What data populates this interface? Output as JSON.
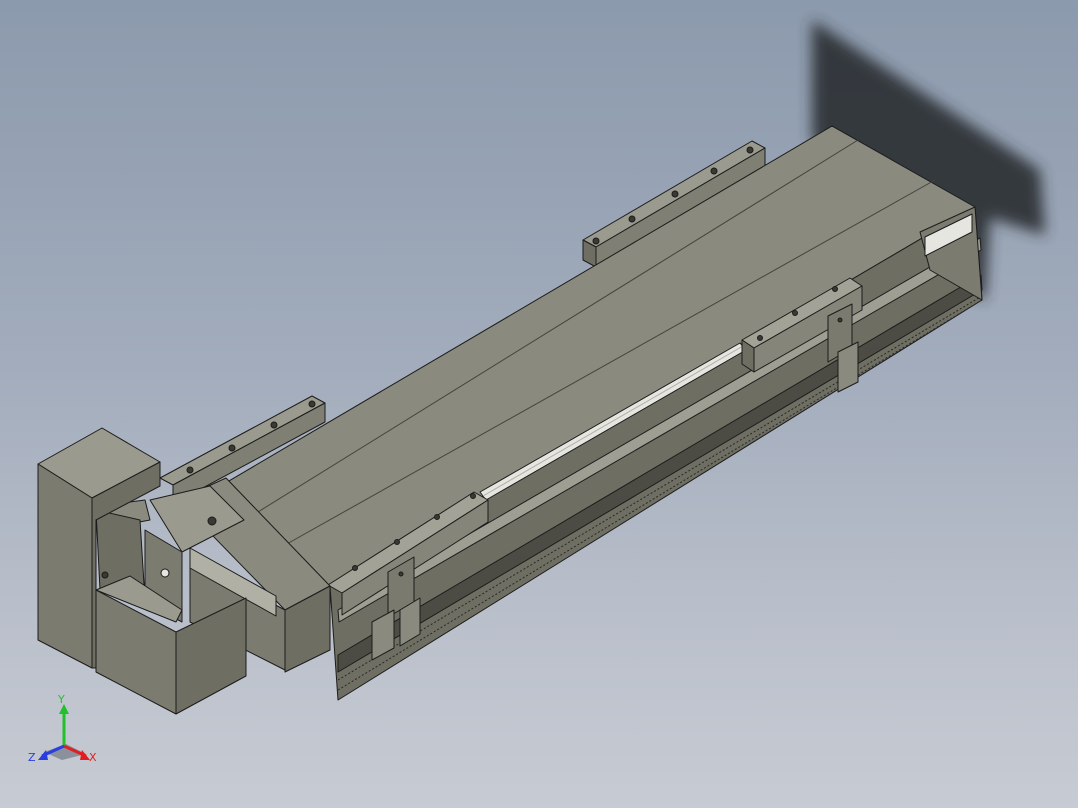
{
  "viewport": {
    "background_top": "#8c9aad",
    "background_bottom": "#c7cbd3",
    "model_colors": {
      "top_face": "#8a8a7e",
      "side_face": "#6e6e63",
      "dark_face": "#55554c",
      "highlight": "#e6e6e0",
      "edge": "#1c1c1c",
      "shadow": "#2a2d33"
    }
  },
  "triad": {
    "x_label": "X",
    "y_label": "Y",
    "z_label": "Z",
    "x_color": "#e02020",
    "y_color": "#22c02a",
    "z_color": "#2a3de0"
  }
}
